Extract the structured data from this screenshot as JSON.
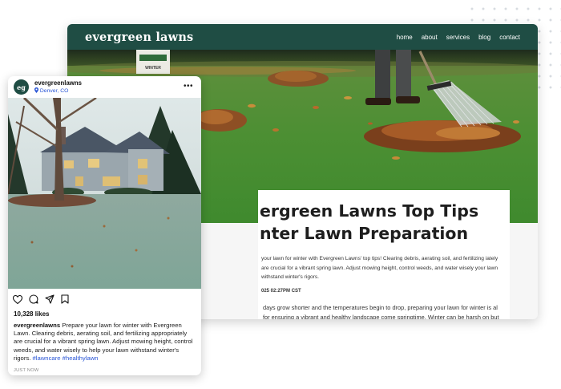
{
  "website": {
    "logo": "evergreen lawns",
    "nav": [
      "home",
      "about",
      "services",
      "blog",
      "contact"
    ],
    "hero": {
      "product_bag_text": "WINTER"
    },
    "article": {
      "title_line1": "ergreen Lawns Top Tips",
      "title_line2": "nter Lawn Preparation",
      "summary": "your lawn for winter with Evergreen Lawns' top tips! Clearing debris, aerating soil, and fertilizing iately are crucial for a vibrant spring lawn. Adjust mowing height, control weeds, and water wisely your lawn withstand winter's rigors.",
      "date": "025 02:27PM CST",
      "body": "days grow shorter and the temperatures begin to drop, preparing your lawn for winter is al for ensuring a vibrant and healthy landscape come springtime. Winter can be harsh on but with the right preparation, you can minimize damage and set the stage for a lush, esurgence. Let's explore some top tips for winter lawn preparation."
    }
  },
  "instagram": {
    "avatar_initials": "eg",
    "username": "evergreenlawns",
    "location": "Denver, CO",
    "more": "•••",
    "likes": "10,328 likes",
    "caption_user": "evergreenlawns",
    "caption": "Prepare your lawn for winter with Evergreen Lawn. Clearing debris, aerating soil, and fertilizing appropriately are crucial for a vibrant spring lawn. Adjust mowing height, control weeds, and water wisely to help your lawn withstand winter's rigors.",
    "hashtags": "#lawncare #healthylawn",
    "timestamp": "JUST NOW"
  },
  "colors": {
    "brand_green": "#1f4d44",
    "link_blue": "#2a56d6"
  }
}
